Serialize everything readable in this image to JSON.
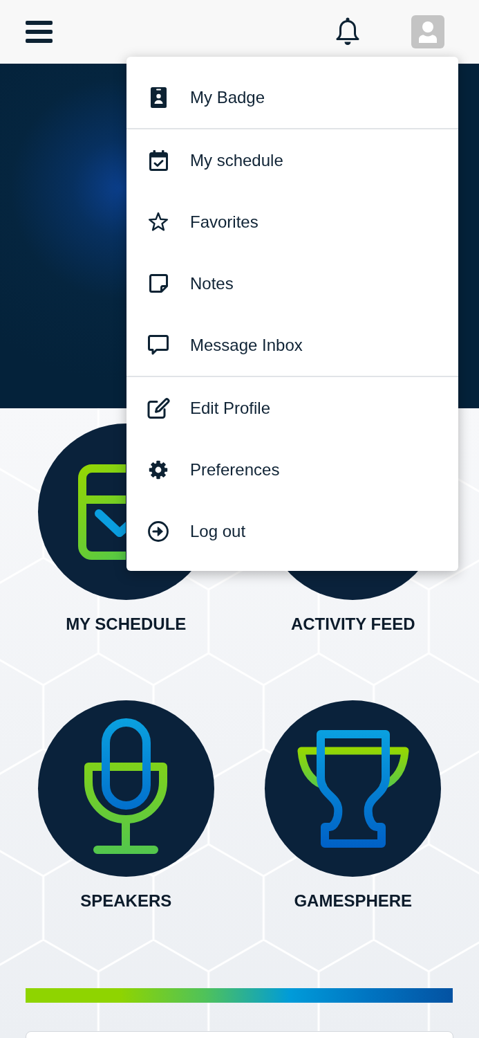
{
  "user_menu": {
    "sections": [
      {
        "items": [
          {
            "label": "My Badge"
          }
        ]
      },
      {
        "items": [
          {
            "label": "My schedule"
          },
          {
            "label": "Favorites"
          },
          {
            "label": "Notes"
          },
          {
            "label": "Message Inbox"
          }
        ]
      },
      {
        "items": [
          {
            "label": "Edit Profile"
          },
          {
            "label": "Preferences"
          },
          {
            "label": "Log out"
          }
        ]
      }
    ]
  },
  "tiles": [
    {
      "label": "MY SCHEDULE"
    },
    {
      "label": "ACTIVITY FEED"
    },
    {
      "label": "SPEAKERS"
    },
    {
      "label": "GAMESPHERE"
    }
  ]
}
